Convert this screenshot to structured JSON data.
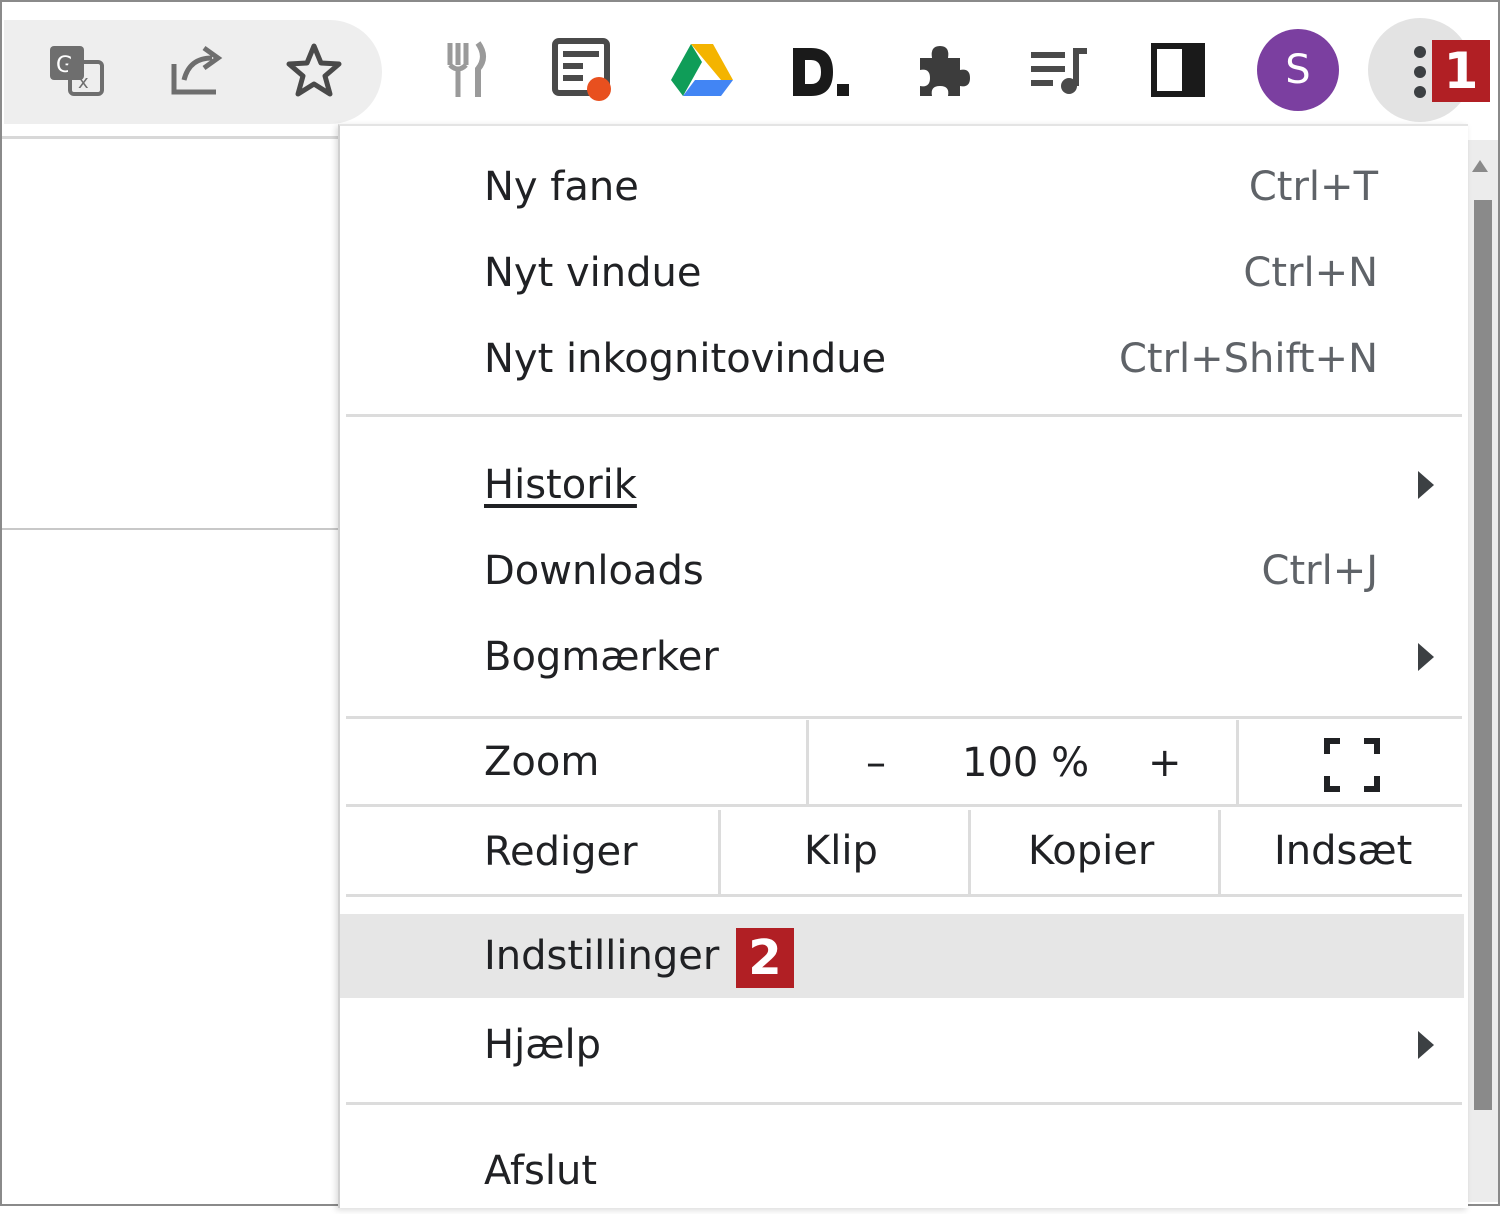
{
  "toolbar": {
    "icons": [
      "translate-icon",
      "share-icon",
      "bookmark-star-icon",
      "restaurant-icon",
      "extension-news-icon",
      "google-drive-icon",
      "d-logo-icon",
      "puzzle-extensions-icon",
      "media-queue-icon",
      "side-panel-icon"
    ],
    "avatar_letter": "S",
    "avatar_color": "#7b3fa0",
    "step_badge": "1"
  },
  "menu": {
    "new_tab": {
      "label": "Ny fane",
      "shortcut": "Ctrl+T"
    },
    "new_window": {
      "label": "Nyt vindue",
      "shortcut": "Ctrl+N"
    },
    "incognito": {
      "label": "Nyt inkognitovindue",
      "shortcut": "Ctrl+Shift+N"
    },
    "history": {
      "label": "Historik"
    },
    "downloads": {
      "label": "Downloads",
      "shortcut": "Ctrl+J"
    },
    "bookmarks": {
      "label": "Bogmærker"
    },
    "zoom": {
      "label": "Zoom",
      "minus": "–",
      "value": "100 %",
      "plus": "+"
    },
    "edit": {
      "label": "Rediger",
      "cut": "Klip",
      "copy": "Kopier",
      "paste": "Indsæt"
    },
    "settings": {
      "label": "Indstillinger",
      "step_badge": "2"
    },
    "help": {
      "label": "Hjælp"
    },
    "exit": {
      "label": "Afslut"
    }
  },
  "colors": {
    "badge": "#b11f24",
    "highlight": "#e6e6e6"
  }
}
